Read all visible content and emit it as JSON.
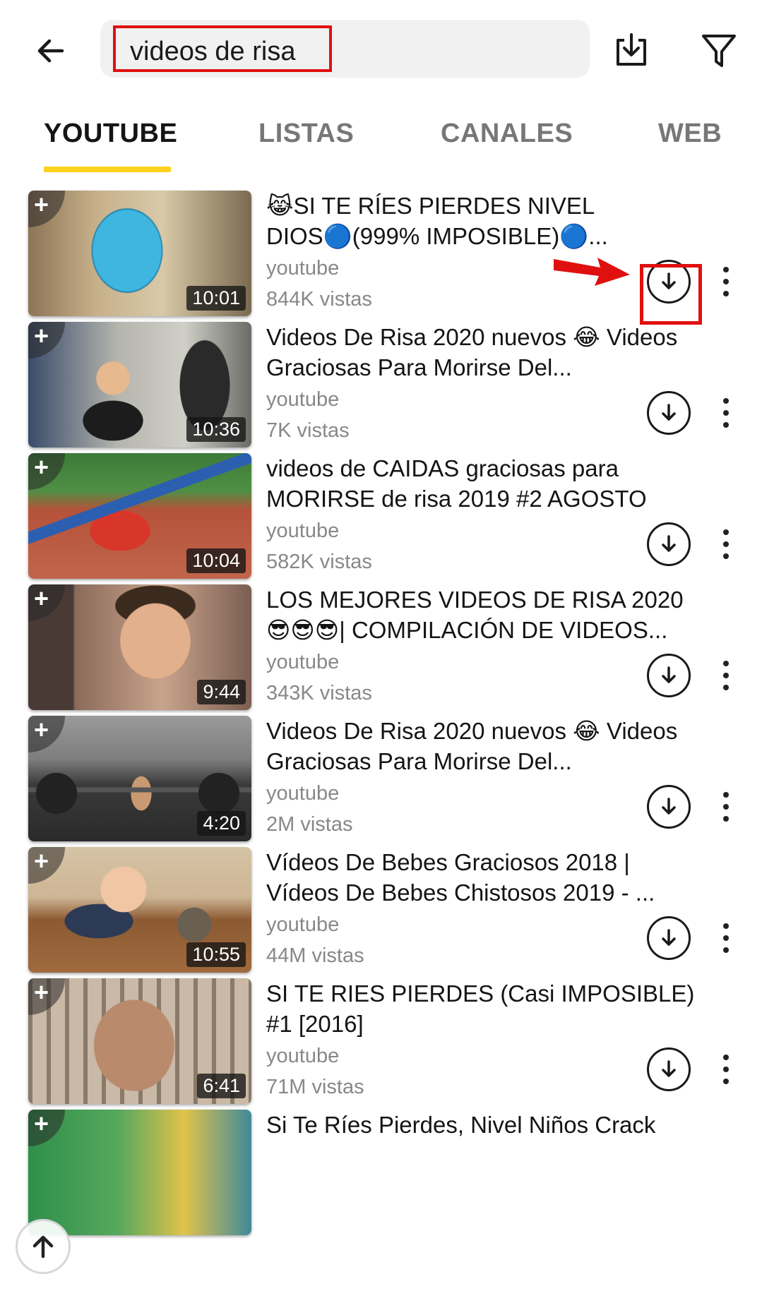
{
  "search": {
    "query": "videos de risa"
  },
  "tabs": [
    {
      "label": "YOUTUBE",
      "active": true
    },
    {
      "label": "LISTAS",
      "active": false
    },
    {
      "label": "CANALES",
      "active": false
    },
    {
      "label": "WEB",
      "active": false
    }
  ],
  "icons": {
    "back": "arrow-left-icon",
    "download_manager": "download-tray-icon",
    "filter": "filter-funnel-icon",
    "item_download": "download-circle-icon",
    "item_more": "more-vertical-icon",
    "add_to_playlist": "plus-icon",
    "scroll_top": "arrow-up-icon"
  },
  "colors": {
    "accent_underline": "#ffd21f",
    "annotation_red": "#e01010"
  },
  "videos": [
    {
      "title": "😹SI TE RÍES PIERDES NIVEL DIOS🔵(999% IMPOSIBLE)🔵...",
      "source": "youtube",
      "views": "844K vistas",
      "duration": "10:01",
      "plus": "+"
    },
    {
      "title": "Videos De Risa 2020 nuevos 😂 Videos Graciosas Para Morirse Del...",
      "source": "youtube",
      "views": "7K vistas",
      "duration": "10:36",
      "plus": "+"
    },
    {
      "title": "videos de CAIDAS graciosas para MORIRSE de risa 2019 #2 AGOSTO",
      "source": "youtube",
      "views": "582K vistas",
      "duration": "10:04",
      "plus": "+"
    },
    {
      "title": "LOS MEJORES VIDEOS DE RISA 2020 😎😎😎| COMPILACIÓN DE VIDEOS...",
      "source": "youtube",
      "views": "343K vistas",
      "duration": "9:44",
      "plus": "+"
    },
    {
      "title": "Videos De Risa 2020 nuevos 😂 Videos Graciosas Para Morirse Del...",
      "source": "youtube",
      "views": "2M vistas",
      "duration": "4:20",
      "plus": "+"
    },
    {
      "title": "Vídeos De Bebes Graciosos 2018 | Vídeos De Bebes Chistosos 2019 - ...",
      "source": "youtube",
      "views": "44M vistas",
      "duration": "10:55",
      "plus": "+"
    },
    {
      "title": "SI TE RIES PIERDES (Casi IMPOSIBLE) #1 [2016]",
      "source": "youtube",
      "views": "71M vistas",
      "duration": "6:41",
      "plus": "+"
    },
    {
      "title": "Si Te Ríes Pierdes, Nivel Niños Crack",
      "source": "",
      "views": "",
      "duration": "",
      "plus": "+"
    }
  ]
}
